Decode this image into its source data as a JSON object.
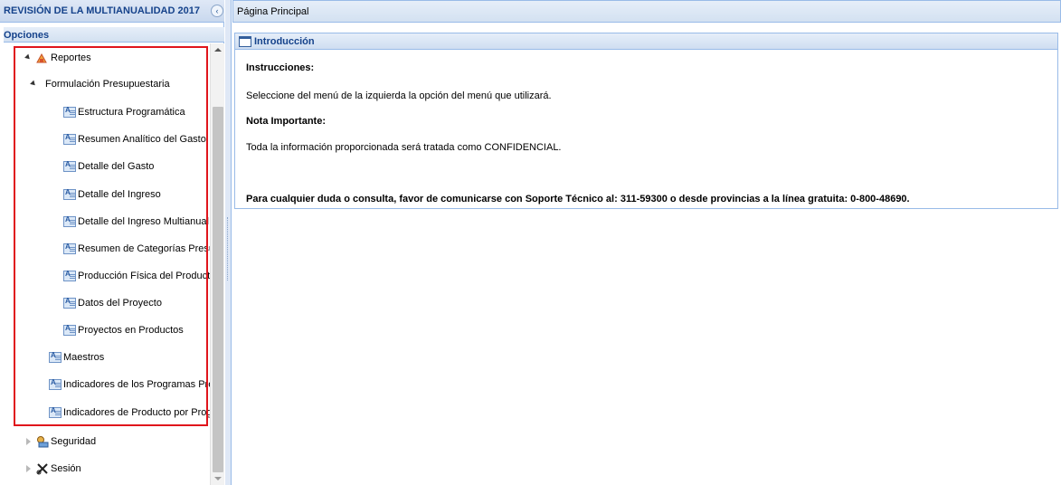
{
  "left_panel": {
    "title": "REVISIÓN DE LA MULTIANUALIDAD 2017",
    "collapse_glyph": "‹",
    "options_title": "Opciones",
    "tree": {
      "reportes": "Reportes",
      "formulacion": "Formulación Presupuestaria",
      "formulacion_items": [
        "Estructura Programática",
        "Resumen Analítico del Gasto",
        "Detalle del Gasto",
        "Detalle del Ingreso",
        "Detalle del Ingreso Multianual",
        "Resumen de Categorías Presup",
        "Producción Física del Producto",
        "Datos del Proyecto",
        "Proyectos en Productos"
      ],
      "maestros": "Maestros",
      "indicadores_programas": "Indicadores de los Programas Pres",
      "indicadores_producto": "Indicadores de Producto por Progra",
      "seguridad": "Seguridad",
      "sesion": "Sesión"
    }
  },
  "main": {
    "title": "Página Principal",
    "intro": {
      "title": "Introducción",
      "instrucciones_heading": "Instrucciones:",
      "instrucciones_text": "Seleccione del menú de la izquierda la opción del menú que utilizará.",
      "nota_heading": "Nota Importante:",
      "nota_text": "Toda la información proporcionada será tratada como CONFIDENCIAL.",
      "contacto": "Para cualquier duda o consulta, favor de comunicarse con Soporte Técnico al: 311-59300 o desde provincias a la línea gratuita: 0-800-48690."
    }
  },
  "colors": {
    "header_text": "#15428b",
    "border": "#99bbe8",
    "highlight_box": "#e0151c"
  }
}
